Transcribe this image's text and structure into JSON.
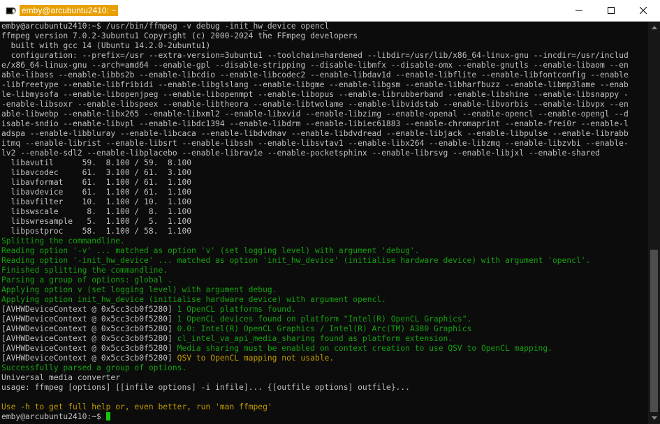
{
  "window": {
    "title": "emby@arcubuntu2410: ~",
    "icon": "terminal-penguin-icon",
    "accent_color": "#e8a000",
    "buttons": [
      "minimize-icon",
      "maximize-icon",
      "close-icon"
    ]
  },
  "terminal": {
    "lines": [
      "emby@arcubuntu2410:~$ /usr/bin/ffmpeg -v debug -init_hw_device opencl",
      "ffmpeg version 7.0.2-3ubuntu1 Copyright (c) 2000-2024 the FFmpeg developers",
      "  built with gcc 14 (Ubuntu 14.2.0-2ubuntu1)",
      "  configuration: --prefix=/usr --extra-version=3ubuntu1 --toolchain=hardened --libdir=/usr/lib/x86_64-linux-gnu --incdir=/usr/includ",
      "e/x86_64-linux-gnu --arch=amd64 --enable-gpl --disable-stripping --disable-libmfx --disable-omx --enable-gnutls --enable-libaom --en",
      "able-libass --enable-libbs2b --enable-libcdio --enable-libcodec2 --enable-libdav1d --enable-libflite --enable-libfontconfig --enable",
      "-libfreetype --enable-libfribidi --enable-libglslang --enable-libgme --enable-libgsm --enable-libharfbuzz --enable-libmp3lame --enab",
      "le-libmysofa --enable-libopenjpeg --enable-libopenmpt --enable-libopus --enable-librubberband --enable-libshine --enable-libsnappy -",
      "-enable-libsoxr --enable-libspeex --enable-libtheora --enable-libtwolame --enable-libvidstab --enable-libvorbis --enable-libvpx --en",
      "able-libwebp --enable-libx265 --enable-libxml2 --enable-libxvid --enable-libzimg --enable-openal --enable-opencl --enable-opengl --d",
      "isable-sndio --enable-libvpl --enable-libdc1394 --enable-libdrm --enable-libiec61883 --enable-chromaprint --enable-frei0r --enable-l",
      "adspa --enable-libbluray --enable-libcaca --enable-libdvdnav --enable-libdvdread --enable-libjack --enable-libpulse --enable-librabb",
      "itmq --enable-librist --enable-libsrt --enable-libssh --enable-libsvtav1 --enable-libx264 --enable-libzmq --enable-libzvbi --enable-",
      "lv2 --enable-sdl2 --enable-libplacebo --enable-librav1e --enable-pocketsphinx --enable-librsvg --enable-libjxl --enable-shared",
      "  libavutil      59.  8.100 / 59.  8.100",
      "  libavcodec     61.  3.100 / 61.  3.100",
      "  libavformat    61.  1.100 / 61.  1.100",
      "  libavdevice    61.  1.100 / 61.  1.100",
      "  libavfilter    10.  1.100 / 10.  1.100",
      "  libswscale      8.  1.100 /  8.  1.100",
      "  libswresample   5.  1.100 /  5.  1.100",
      "  libpostproc    58.  1.100 / 58.  1.100",
      "Splitting the commandline.",
      "Reading option '-v' ... matched as option 'v' (set logging level) with argument 'debug'.",
      "Reading option '-init_hw_device' ... matched as option 'init_hw_device' (initialise hardware device) with argument 'opencl'.",
      "Finished splitting the commandline.",
      "Parsing a group of options: global .",
      "Applying option v (set logging level) with argument debug.",
      "Applying option init_hw_device (initialise hardware device) with argument opencl.",
      "Successfully parsed a group of options.",
      "Universal media converter",
      "usage: ffmpeg [options] [[infile options] -i infile]... {[outfile options] outfile}...",
      "",
      "Use -h to get full help or, even better, run 'man ffmpeg'"
    ],
    "hw_lines": [
      {
        "prefix": "[AVHWDeviceContext @ 0x5cc3cb0f5280] ",
        "message": "1 OpenCL platforms found."
      },
      {
        "prefix": "[AVHWDeviceContext @ 0x5cc3cb0f5280] ",
        "message": "1 OpenCL devices found on platform \"Intel(R) OpenCL Graphics\"."
      },
      {
        "prefix": "[AVHWDeviceContext @ 0x5cc3cb0f5280] ",
        "message": "0.0: Intel(R) OpenCL Graphics / Intel(R) Arc(TM) A380 Graphics"
      },
      {
        "prefix": "[AVHWDeviceContext @ 0x5cc3cb0f5280] ",
        "message": "cl_intel_va_api_media_sharing found as platform extension."
      },
      {
        "prefix": "[AVHWDeviceContext @ 0x5cc3cb0f5280] ",
        "message": "Media sharing must be enabled on context creation to use QSV to OpenCL mapping."
      },
      {
        "prefix": "[AVHWDeviceContext @ 0x5cc3cb0f5280] ",
        "message": "QSV to OpenCL mapping not usable."
      }
    ],
    "prompt": "emby@arcubuntu2410:~$ ",
    "colors": {
      "text": "#c0c0c0",
      "verbose": "#13a10e",
      "warning": "#c19c00",
      "cursor": "#16c60c",
      "background": "#0c0c0c"
    }
  },
  "scrollbar": {
    "visible_fraction": 0.43,
    "position": "bottom"
  }
}
